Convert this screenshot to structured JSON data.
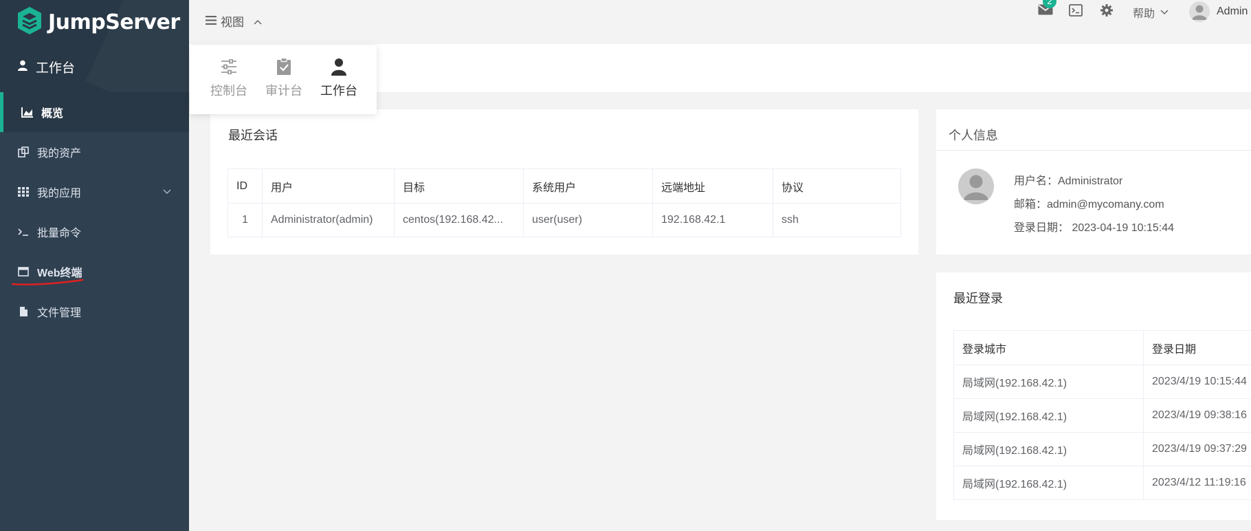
{
  "brand": {
    "name": "JumpServer"
  },
  "sidebar": {
    "workspace_title": "工作台",
    "items": [
      {
        "label": "概览"
      },
      {
        "label": "我的资产"
      },
      {
        "label": "我的应用"
      },
      {
        "label": "批量命令"
      },
      {
        "label": "Web终端"
      },
      {
        "label": "文件管理"
      }
    ]
  },
  "topbar": {
    "view_label": "视图",
    "mail_count": "2",
    "help_label": "帮助",
    "user_label": "Admin"
  },
  "view_dropdown": {
    "items": [
      {
        "label": "控制台"
      },
      {
        "label": "审计台"
      },
      {
        "label": "工作台"
      }
    ]
  },
  "recent_sessions": {
    "title": "最近会话",
    "columns": [
      "ID",
      "用户",
      "目标",
      "系统用户",
      "远端地址",
      "协议"
    ],
    "rows": [
      [
        "1",
        "Administrator(admin)",
        "centos(192.168.42...",
        "user(user)",
        "192.168.42.1",
        "ssh"
      ]
    ]
  },
  "profile": {
    "title": "个人信息",
    "username": "用户名：Administrator",
    "email": "邮箱：admin@mycomany.com",
    "login_date": "登录日期： 2023-04-19 10:15:44"
  },
  "recent_logins": {
    "title": "最近登录",
    "columns": [
      "登录城市",
      "登录日期"
    ],
    "rows": [
      [
        "局域网(192.168.42.1)",
        "2023/4/19 10:15:44"
      ],
      [
        "局域网(192.168.42.1)",
        "2023/4/19 09:38:16"
      ],
      [
        "局域网(192.168.42.1)",
        "2023/4/19 09:37:29"
      ],
      [
        "局域网(192.168.42.1)",
        "2023/4/12 11:19:16"
      ]
    ]
  },
  "colors": {
    "accent": "#1ab394",
    "sidebar_bg": "#2f4050",
    "underline": "#e02020"
  }
}
